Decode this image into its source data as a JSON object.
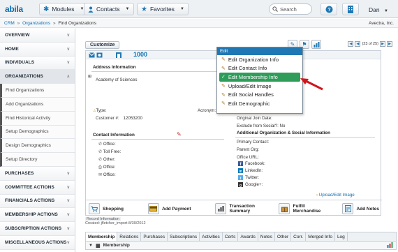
{
  "app": {
    "logo": "abila",
    "modules_label": "Modules",
    "contacts_label": "Contacts",
    "favorites_label": "Favorites",
    "search_placeholder": "Search",
    "user_label": "Dan"
  },
  "breadcrumb": {
    "items": [
      "CRM",
      "Organizations",
      "Find Organizations"
    ],
    "separator": "»",
    "org_name": "Avectra, Inc."
  },
  "sidebar": {
    "items": [
      {
        "label": "OVERVIEW",
        "type": "head"
      },
      {
        "label": "HOME",
        "type": "head"
      },
      {
        "label": "INDIVIDUALS",
        "type": "head"
      },
      {
        "label": "ORGANIZATIONS",
        "type": "head-open"
      },
      {
        "label": "Find Organizations",
        "type": "sub"
      },
      {
        "label": "Add Organizations",
        "type": "sub"
      },
      {
        "label": "Find Historical Activity",
        "type": "sub"
      },
      {
        "label": "Setup Demographics",
        "type": "sub"
      },
      {
        "label": "Design Demographics",
        "type": "sub"
      },
      {
        "label": "Setup Directory",
        "type": "sub"
      },
      {
        "label": "PURCHASES",
        "type": "head"
      },
      {
        "label": "COMMITTEE ACTIONS",
        "type": "head"
      },
      {
        "label": "FINANCIALS ACTIONS",
        "type": "head"
      },
      {
        "label": "MEMBERSHIP ACTIONS",
        "type": "head"
      },
      {
        "label": "SUBSCRIPTION ACTIONS",
        "type": "head"
      },
      {
        "label": "MISCELLANEOUS ACTIONS",
        "type": "head"
      }
    ]
  },
  "main": {
    "customize_label": "Customize",
    "record_number": "1000",
    "pager_text": "(23 of 25)",
    "address_section": "Address Information",
    "org_name": "Academy of Sciences",
    "type_label": "Type:",
    "acronym_label": "Acronym:",
    "customer_label": "Customer #:",
    "customer_value": "12053200",
    "contact_section": "Contact Information",
    "contact_fields": [
      "Office:",
      "Toll Free:",
      "Other:",
      "Office:",
      "Office:"
    ],
    "original_join_label": "Original Join Date:",
    "exclude_social_label": "Exclude from Social?: No",
    "additional_section": "Additional Organization & Social Information",
    "primary_contact_label": "Primary Contact:",
    "parent_org_label": "Parent Org:",
    "office_url_label": "Office URL:",
    "social": [
      "Facebook:",
      "LinkedIn:",
      "Twitter:",
      "Google+:"
    ],
    "upload_link": "Upload/Edit Image",
    "actions": [
      {
        "label": "Shopping"
      },
      {
        "label": "Add Payment"
      },
      {
        "label": "Transaction Summary"
      },
      {
        "label": "Fulfill Merchandise"
      },
      {
        "label": "Add Notes"
      }
    ],
    "record_info_title": "Record Information",
    "record_info_created": "Created: jfletcher_import-8/30/2012"
  },
  "edit_menu": {
    "title": "Edit",
    "items": [
      {
        "label": "Edit Organization Info"
      },
      {
        "label": "Edit Contact Info"
      },
      {
        "label": "Edit Membership Info",
        "active": true
      },
      {
        "label": "Upload/Edit Image"
      },
      {
        "label": "Edit Social Handles"
      },
      {
        "label": "Edit Demographic"
      }
    ]
  },
  "tabs": {
    "items": [
      "Membership",
      "Relations",
      "Purchases",
      "Subscriptions",
      "Activities",
      "Certs",
      "Awards",
      "Notes",
      "Other",
      "Corr.",
      "Merged Info",
      "Log"
    ],
    "active": "Membership",
    "subtab_label": "Membership"
  },
  "colors": {
    "accent": "#0e6fb0",
    "menu_header": "#1f78b4",
    "menu_active": "#2f9c5a",
    "arrow": "#d0161b"
  }
}
